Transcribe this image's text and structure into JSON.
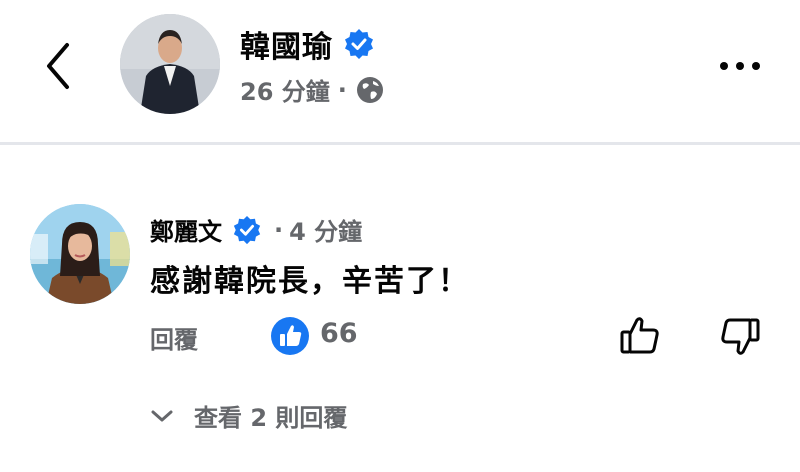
{
  "post": {
    "author_name": "韓國瑜",
    "time": "26 分鐘",
    "separator": "·",
    "audience_icon": "globe-icon"
  },
  "comment": {
    "author_name": "鄭麗文",
    "separator": "·",
    "time": "4 分鐘",
    "text": "感謝韓院長，辛苦了！",
    "reply_label": "回覆",
    "like_count": "66",
    "view_replies_label": "查看 2 則回覆"
  },
  "colors": {
    "verified_blue": "#1877f2",
    "secondary_text": "#65676b",
    "divider": "#e4e6eb"
  }
}
